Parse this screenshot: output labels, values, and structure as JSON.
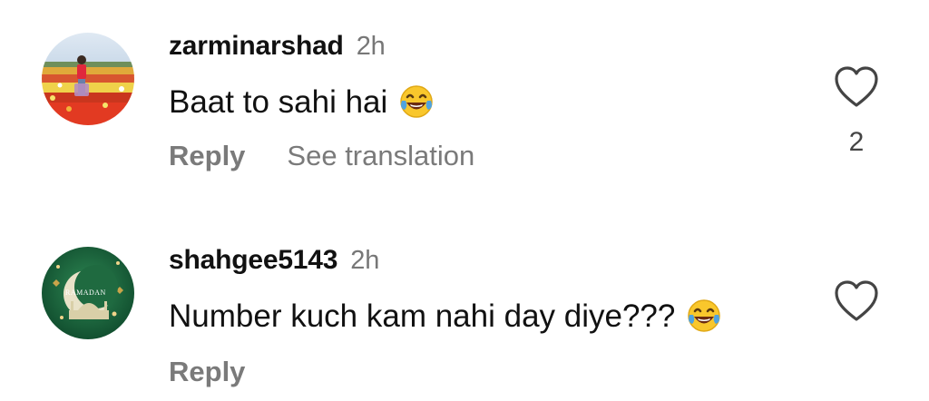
{
  "comments": [
    {
      "username": "zarminarshad",
      "time": "2h",
      "text": "Baat to sahi hai",
      "emoji": "face-with-tears-of-joy",
      "actions": {
        "reply": "Reply",
        "translate": "See translation"
      },
      "likes": "2",
      "avatar": "avatar-flower-field-photo"
    },
    {
      "username": "shahgee5143",
      "time": "2h",
      "text": "Number kuch kam nahi day diye???",
      "emoji": "face-with-tears-of-joy",
      "actions": {
        "reply": "Reply"
      },
      "avatar": "avatar-ramadan-crescent",
      "avatar_text": "RAMADAN"
    }
  ],
  "colors": {
    "background": "#ffffff",
    "text": "#111111",
    "muted": "#7a7a7a",
    "icon": "#444444"
  }
}
